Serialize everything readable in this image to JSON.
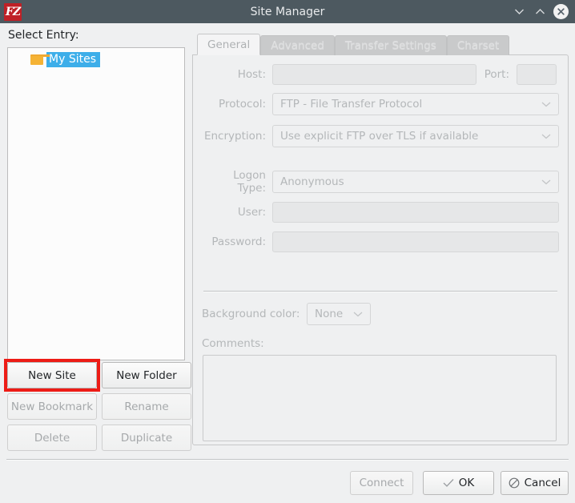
{
  "window": {
    "title": "Site Manager",
    "logo_text": "FZ",
    "logo_color": "#bf2026",
    "titlebar_color": "#4d5960",
    "controls": [
      {
        "name": "minimize",
        "icon": "chevron-down-icon"
      },
      {
        "name": "maximize",
        "icon": "chevron-up-icon"
      },
      {
        "name": "close",
        "icon": "close-icon"
      }
    ]
  },
  "left": {
    "select_entry_label": "Select Entry:",
    "tree": {
      "items": [
        {
          "label": "My Sites",
          "icon": "folder-icon",
          "selected": true
        }
      ],
      "selection_color": "#3daee9",
      "folder_color": "#f5b335"
    },
    "buttons": [
      {
        "label": "New Site",
        "enabled": true,
        "highlighted": true
      },
      {
        "label": "New Folder",
        "enabled": true,
        "highlighted": false
      },
      {
        "label": "New Bookmark",
        "enabled": false,
        "highlighted": false
      },
      {
        "label": "Rename",
        "enabled": false,
        "highlighted": false
      },
      {
        "label": "Delete",
        "enabled": false,
        "highlighted": false
      },
      {
        "label": "Duplicate",
        "enabled": false,
        "highlighted": false
      }
    ],
    "highlight_color": "#ed1c16"
  },
  "tabs": [
    {
      "label": "General",
      "active": true,
      "enabled": true
    },
    {
      "label": "Advanced",
      "active": false,
      "enabled": false
    },
    {
      "label": "Transfer Settings",
      "active": false,
      "enabled": false
    },
    {
      "label": "Charset",
      "active": false,
      "enabled": false
    }
  ],
  "general": {
    "host_label": "Host:",
    "host_value": "",
    "port_label": "Port:",
    "port_value": "",
    "protocol_label": "Protocol:",
    "protocol_value": "FTP - File Transfer Protocol",
    "encryption_label": "Encryption:",
    "encryption_value": "Use explicit FTP over TLS if available",
    "logon_type_label": "Logon Type:",
    "logon_type_value": "Anonymous",
    "user_label": "User:",
    "user_value": "",
    "password_label": "Password:",
    "password_value": "",
    "background_color_label": "Background color:",
    "background_color_value": "None",
    "comments_label": "Comments:",
    "comments_value": ""
  },
  "footer": {
    "connect_label": "Connect",
    "connect_enabled": false,
    "ok_label": "OK",
    "ok_icon": "checkmark-icon",
    "cancel_label": "Cancel",
    "cancel_icon": "prohibition-icon"
  }
}
